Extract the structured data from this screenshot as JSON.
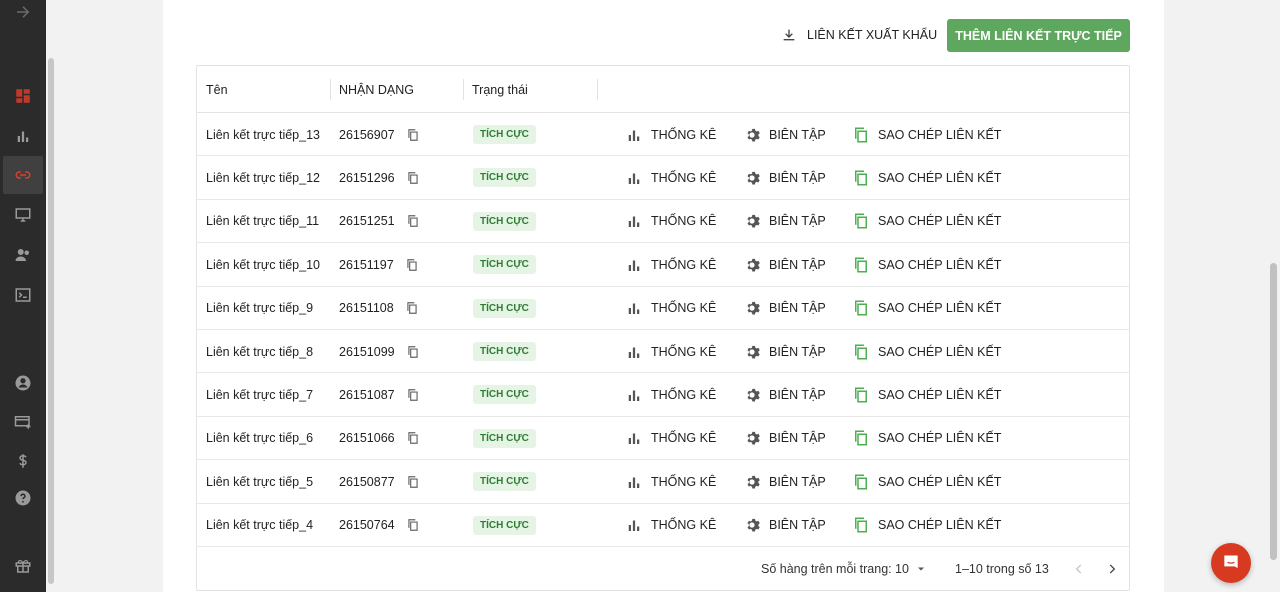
{
  "sidebar": {
    "items": [
      {
        "icon": "arrow-right-icon"
      },
      {
        "icon": "dashboard-icon"
      },
      {
        "icon": "bar-chart-icon"
      },
      {
        "icon": "link-icon",
        "active": true
      },
      {
        "icon": "monitor-icon"
      },
      {
        "icon": "users-icon"
      },
      {
        "icon": "terminal-icon"
      },
      {
        "icon": "account-icon"
      },
      {
        "icon": "billing-icon"
      },
      {
        "icon": "dollar-icon"
      },
      {
        "icon": "help-icon"
      },
      {
        "icon": "gift-icon"
      }
    ]
  },
  "toolbar": {
    "export_label": "LIÊN KẾT XUẤT KHẨU",
    "add_label": "THÊM LIÊN KẾT TRỰC TIẾP"
  },
  "table": {
    "columns": [
      "Tên",
      "NHẬN DẠNG",
      "Trạng thái"
    ],
    "actions": {
      "stats": "THỐNG KÊ",
      "edit": "BIÊN TẬP",
      "copy": "SAO CHÉP LIÊN KẾT"
    },
    "rows": [
      {
        "name": "Liên kết trực tiếp_13",
        "id": "26156907",
        "status": "TÍCH CỰC"
      },
      {
        "name": "Liên kết trực tiếp_12",
        "id": "26151296",
        "status": "TÍCH CỰC"
      },
      {
        "name": "Liên kết trực tiếp_11",
        "id": "26151251",
        "status": "TÍCH CỰC"
      },
      {
        "name": "Liên kết trực tiếp_10",
        "id": "26151197",
        "status": "TÍCH CỰC"
      },
      {
        "name": "Liên kết trực tiếp_9",
        "id": "26151108",
        "status": "TÍCH CỰC"
      },
      {
        "name": "Liên kết trực tiếp_8",
        "id": "26151099",
        "status": "TÍCH CỰC"
      },
      {
        "name": "Liên kết trực tiếp_7",
        "id": "26151087",
        "status": "TÍCH CỰC"
      },
      {
        "name": "Liên kết trực tiếp_6",
        "id": "26151066",
        "status": "TÍCH CỰC"
      },
      {
        "name": "Liên kết trực tiếp_5",
        "id": "26150877",
        "status": "TÍCH CỰC"
      },
      {
        "name": "Liên kết trực tiếp_4",
        "id": "26150764",
        "status": "TÍCH CỰC"
      }
    ]
  },
  "pagination": {
    "rows_per_page_label": "Số hàng trên mỗi trang:",
    "rows_per_page_value": "10",
    "range_label": "1–10 trong số 13"
  },
  "colors": {
    "sidebar_bg": "#2b2b2b",
    "accent_green": "#5ea75e",
    "active_link_red": "#d8412f",
    "chat_bubble": "#d83a21"
  }
}
